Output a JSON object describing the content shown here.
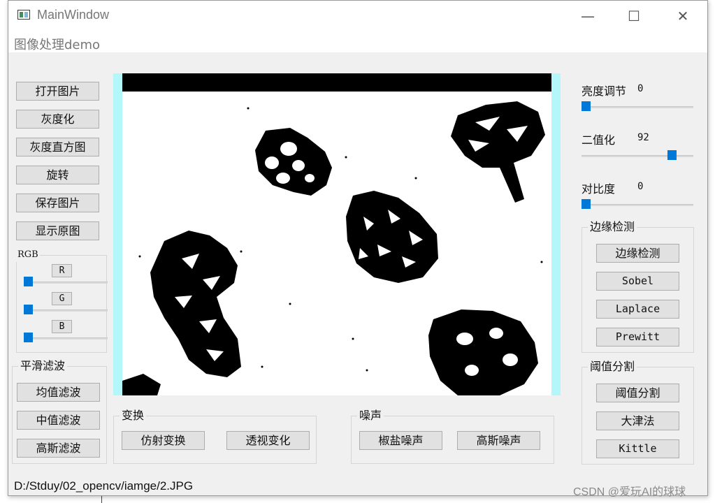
{
  "window": {
    "title": "MainWindow",
    "controls": {
      "minimize": "—",
      "maximize": "☐",
      "close": "✕"
    }
  },
  "menu": {
    "items": [
      "图像处理demo"
    ]
  },
  "left_buttons": [
    "打开图片",
    "灰度化",
    "灰度直方图",
    "旋转",
    "保存图片",
    "显示原图"
  ],
  "rgb": {
    "title": "RGB",
    "channels": [
      {
        "label": "R",
        "value": 0
      },
      {
        "label": "G",
        "value": 0
      },
      {
        "label": "B",
        "value": 0
      }
    ]
  },
  "smoothing": {
    "title": "平滑滤波",
    "buttons": [
      "均值滤波",
      "中值滤波",
      "高斯滤波"
    ]
  },
  "transform": {
    "title": "变换",
    "buttons": [
      "仿射变换",
      "透视变化"
    ]
  },
  "noise": {
    "title": "噪声",
    "buttons": [
      "椒盐噪声",
      "高斯噪声"
    ]
  },
  "sliders": {
    "brightness": {
      "label": "亮度调节",
      "value": "0",
      "level": 0.0
    },
    "binarize": {
      "label": "二值化",
      "value": "92",
      "level": 0.84
    },
    "contrast": {
      "label": "对比度",
      "value": "0",
      "level": 0.0
    }
  },
  "edge": {
    "title": "边缘检测",
    "buttons": [
      "边缘检测",
      "Sobel",
      "Laplace",
      "Prewitt"
    ]
  },
  "threshold": {
    "title": "阈值分割",
    "buttons": [
      "阈值分割",
      "大津法",
      "Kittle"
    ]
  },
  "image": {
    "description_colors": {
      "foreground": "#000000",
      "background": "#ffffff",
      "border": "#b3f7fb"
    }
  },
  "status": {
    "path": "D:/Stduy/02_opencv/iamge/2.JPG"
  },
  "watermark": "CSDN @爱玩AI的球球",
  "accent_color": "#0078d7"
}
